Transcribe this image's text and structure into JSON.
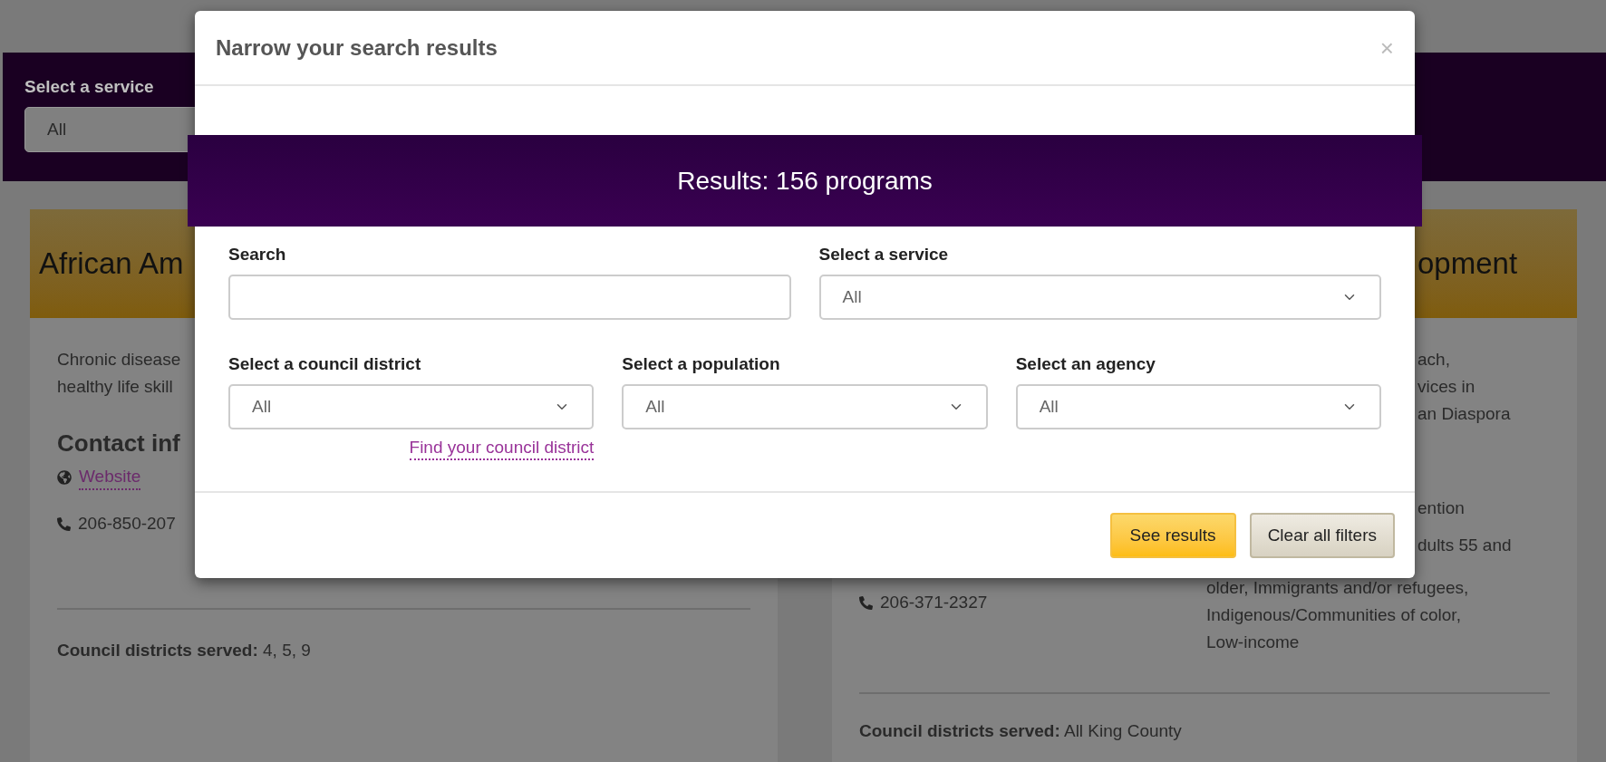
{
  "background": {
    "filter_bar": {
      "label": "Select a service",
      "value": "All"
    },
    "left_card": {
      "title": "African Am",
      "description": [
        "Chronic disease",
        "healthy life skill"
      ],
      "contact_heading": "Contact inf",
      "website": "Website",
      "phone": "206-850-207",
      "council_label": "Council districts served:",
      "council_value": "4, 5, 9"
    },
    "right_card": {
      "title": "opment",
      "description": [
        "ach,",
        "vices in",
        "an Diaspora"
      ],
      "detail_lines": [
        "ention",
        "dults 55 and"
      ],
      "population_lines": [
        "older, Immigrants and/or refugees,",
        "Indigenous/Communities of color,",
        "Low-income"
      ],
      "phone": "206-371-2327",
      "council_label": "Council districts served:",
      "council_value": "All King County"
    }
  },
  "modal": {
    "title": "Narrow your search results",
    "close": "×",
    "results": "Results: 156 programs",
    "field_rows": [
      [
        {
          "kind": "text",
          "label": "Search"
        },
        {
          "kind": "select",
          "label": "Select a service",
          "value": "All"
        }
      ],
      [
        {
          "kind": "select",
          "label": "Select a council district",
          "value": "All",
          "link": "Find your council district"
        },
        {
          "kind": "select",
          "label": "Select a population",
          "value": "All"
        },
        {
          "kind": "select",
          "label": "Select an agency",
          "value": "All"
        }
      ]
    ],
    "buttons": [
      {
        "label": "See results",
        "kind": "primary"
      },
      {
        "label": "Clear all filters",
        "kind": "secondary"
      }
    ]
  }
}
